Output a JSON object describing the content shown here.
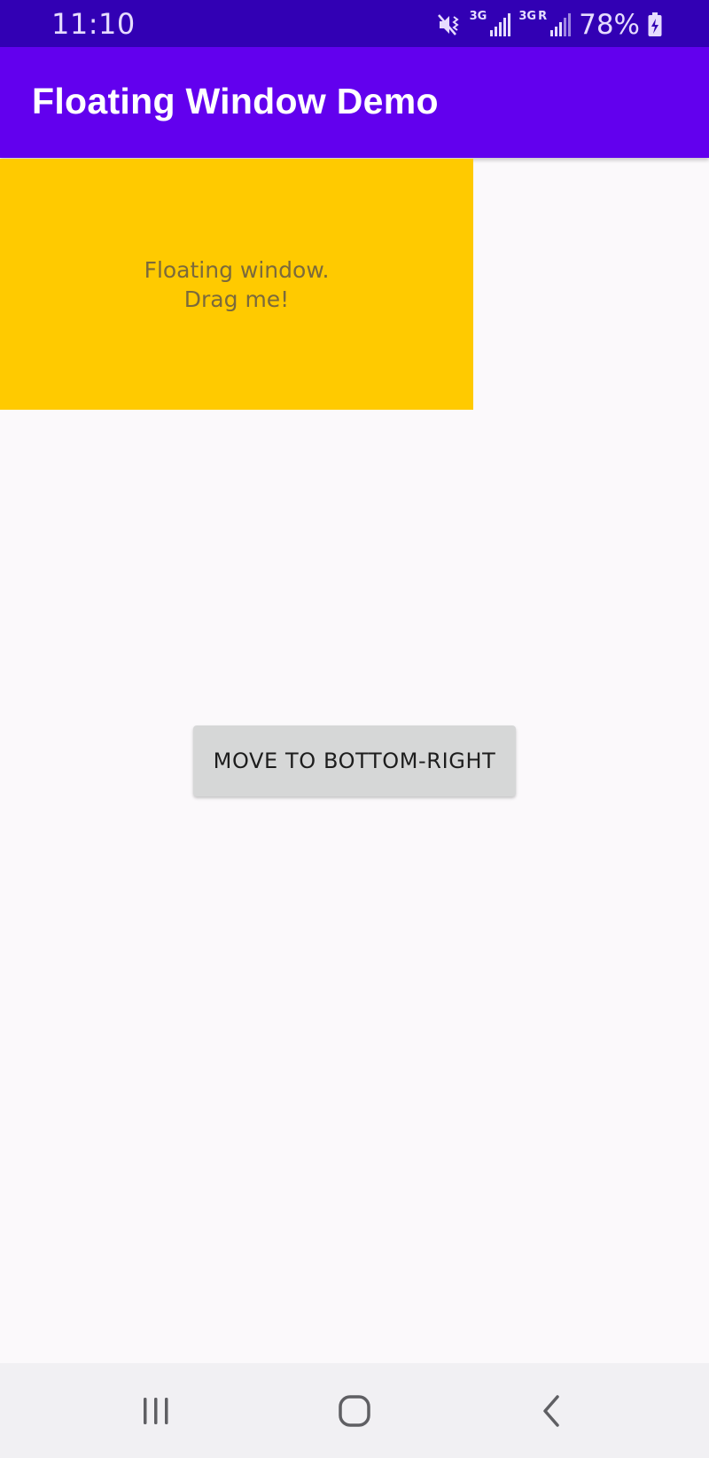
{
  "status_bar": {
    "time": "11:10",
    "net1_label": "3G",
    "net2_label": "3G",
    "roaming_label": "R",
    "battery_percent": "78%",
    "icons": [
      "mute-vibrate-icon",
      "signal-icon",
      "signal-roaming-icon",
      "battery-charging-icon"
    ]
  },
  "app_bar": {
    "title": "Floating Window Demo"
  },
  "floating_window": {
    "line1": "Floating window.",
    "line2": "Drag me!"
  },
  "move_button": {
    "label": "MOVE TO BOTTOM-RIGHT"
  },
  "navigation_bar": {
    "buttons": [
      "recents-icon",
      "home-icon",
      "back-icon"
    ]
  },
  "colors": {
    "status_bar": "#3200b4",
    "app_bar": "#6200ee",
    "floating_window": "#ffca00",
    "button": "#d6d7d7",
    "background": "#fbf9fb"
  }
}
